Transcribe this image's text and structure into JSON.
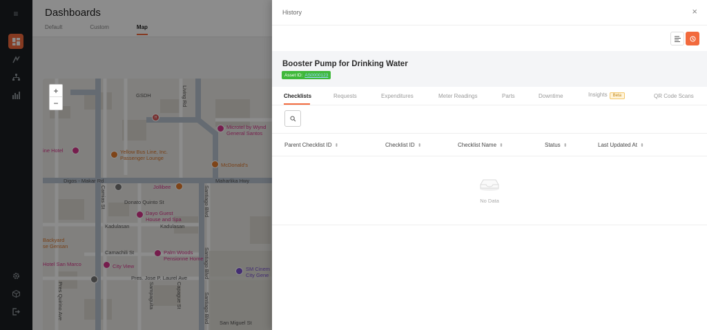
{
  "rail": {
    "items": [
      {
        "icon": "menu-icon"
      },
      {
        "icon": "dashboard-icon"
      },
      {
        "icon": "asset-icon"
      },
      {
        "icon": "org-icon"
      },
      {
        "icon": "analytics-icon"
      },
      {
        "icon": "settings-icon"
      },
      {
        "icon": "box-icon"
      },
      {
        "icon": "logout-icon"
      }
    ]
  },
  "background": {
    "title": "Dashboards",
    "tabs": [
      "Default",
      "Custom",
      "Map"
    ],
    "map": {
      "zoom_in": "+",
      "zoom_out": "−",
      "labels": {
        "gsdh": "GSDH",
        "microtel": "Microtel by Wynd",
        "microtel2": "General Santos",
        "hotel": "ine Hotel",
        "yellowbus": "Yellow Bus Line, Inc.",
        "yellowbus2": "Passenger Lounge",
        "mcdonalds": "McDonald's",
        "digos": "Digos - Makar Rd",
        "maharlika": "Maharlika Hwy",
        "jollibee": "Jollibee",
        "donato": "Donato Quinto St",
        "dayo": "Dayo Guest",
        "dayo2": "House and Spa",
        "kadulasan": "Kadulasan",
        "kadulasan2": "Kadulasan",
        "backyard": "Backyard",
        "backyard2": "se Gensan",
        "camachili": "Camachili St",
        "palmwoods": "Palm Woods",
        "palmwoods2": "Pensionne Home",
        "hotelsanmarco": "Hotel San Marco",
        "cityview": "City View",
        "smcinema": "SM Cinem",
        "smcinema2": "City Gene",
        "laurel": "Pres. Jose P. Laurel Ave",
        "sanmiguel": "San Miguel St",
        "living": "Living Rd",
        "camias": "Camias St",
        "santiago": "Santiago Blvd",
        "santiago2": "Santiago Blvd",
        "santiago3": "Santiago Blvd",
        "presquirino": "Pres Quirino Ave",
        "calamansi": "Calamansi",
        "sampaguita": "Sampaguita",
        "cabayhay": "Capague St"
      }
    }
  },
  "drawer": {
    "title": "History",
    "close": "×",
    "asset_name": "Booster Pump for Drinking Water",
    "asset_id_label": "Asset ID:",
    "asset_id_value": "AS0000123",
    "tabs": [
      "Checklists",
      "Requests",
      "Expenditures",
      "Meter Readings",
      "Parts",
      "Downtime",
      "Insights",
      "QR Code Scans"
    ],
    "beta": "Beta",
    "columns": [
      "Parent Checklist ID",
      "Checklist ID",
      "Checklist Name",
      "Status",
      "Last Updated At"
    ],
    "empty_text": "No Data"
  }
}
